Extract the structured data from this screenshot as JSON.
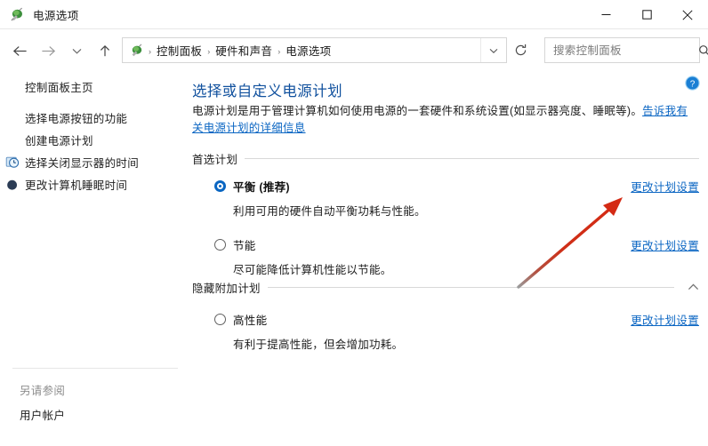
{
  "window": {
    "title": "电源选项",
    "icon": "power-plug-icon",
    "controls": {
      "minimize": "最小化",
      "maximize": "最大化",
      "close": "关闭"
    }
  },
  "nav": {
    "back": "后退",
    "forward": "前进",
    "recent": "最近使用的位置",
    "up": "上移一级",
    "refresh": "刷新",
    "address_icon": "power-plug-icon",
    "breadcrumbs": [
      "控制面板",
      "硬件和声音",
      "电源选项"
    ],
    "separator": "›",
    "dropdown": "地址栏下拉"
  },
  "search": {
    "placeholder": "搜索控制面板",
    "value": "",
    "icon": "search-icon"
  },
  "help": {
    "label": "帮助",
    "glyph": "?",
    "color": "#1a7fd4"
  },
  "sidebar": {
    "home": "控制面板主页",
    "items": [
      {
        "label": "选择电源按钮的功能",
        "icon": null
      },
      {
        "label": "创建电源计划",
        "icon": null
      },
      {
        "label": "选择关闭显示器的时间",
        "icon": "clock-icon"
      },
      {
        "label": "更改计算机睡眠时间",
        "icon": "moon-icon"
      }
    ],
    "see_also_label": "另请参阅",
    "see_also_items": [
      "用户帐户"
    ]
  },
  "main": {
    "heading": "选择或自定义电源计划",
    "description_before": "电源计划是用于管理计算机如何使用电源的一套硬件和系统设置(如显示器亮度、睡眠等)。",
    "description_link": "告诉我有关电源计划的详细信息",
    "groups": [
      {
        "title": "首选计划",
        "collapsible": false,
        "plans": [
          {
            "name": "平衡 (推荐)",
            "selected": true,
            "description": "利用可用的硬件自动平衡功耗与性能。",
            "action": "更改计划设置"
          },
          {
            "name": "节能",
            "selected": false,
            "description": "尽可能降低计算机性能以节能。",
            "action": "更改计划设置"
          }
        ]
      },
      {
        "title": "隐藏附加计划",
        "collapsible": true,
        "chevron": "chevron-up-icon",
        "plans": [
          {
            "name": "高性能",
            "selected": false,
            "description": "有利于提高性能，但会增加功耗。",
            "action": "更改计划设置"
          }
        ]
      }
    ]
  },
  "annotation": {
    "type": "arrow",
    "color": "#d42a14",
    "points_to": "更改计划设置"
  },
  "colors": {
    "heading_blue": "#11519e",
    "link_blue": "#0b66c3",
    "radio_selected": "#0a66c2",
    "annotation_red": "#d42a14",
    "background": "#ffffff"
  }
}
